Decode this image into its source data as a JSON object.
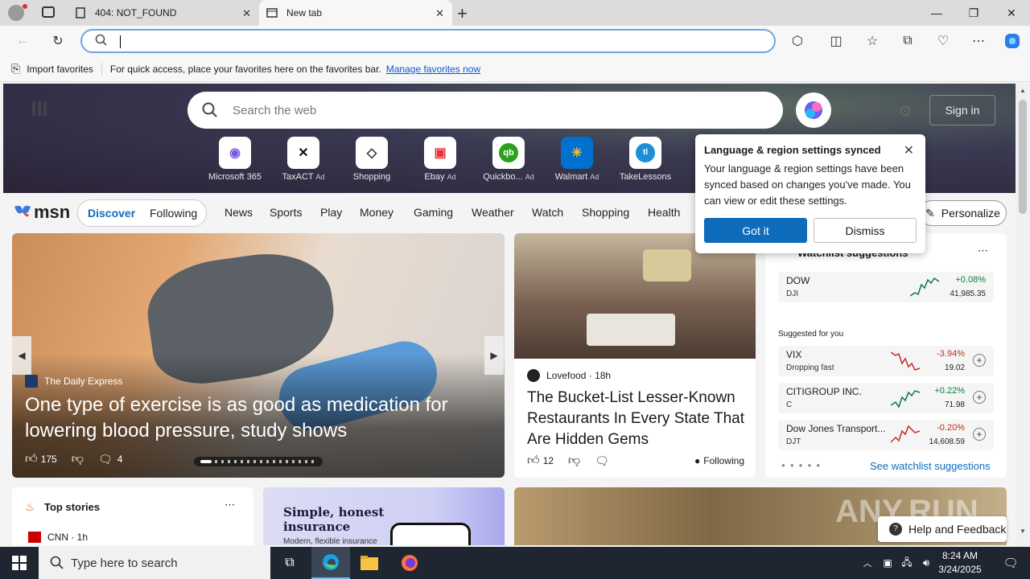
{
  "browser": {
    "tabs": [
      {
        "title": "404: NOT_FOUND"
      },
      {
        "title": "New tab"
      }
    ],
    "address_value": "",
    "favorites_bar": {
      "import_label": "Import favorites",
      "hint": "For quick access, place your favorites here on the favorites bar.",
      "manage_link": "Manage favorites now"
    }
  },
  "msn": {
    "search_placeholder": "Search the web",
    "sign_in": "Sign in",
    "quick_links": [
      {
        "label": "Microsoft 365",
        "ad": ""
      },
      {
        "label": "TaxACT",
        "ad": "Ad"
      },
      {
        "label": "Shopping",
        "ad": ""
      },
      {
        "label": "Ebay",
        "ad": "Ad"
      },
      {
        "label": "Quickbo...",
        "ad": "Ad"
      },
      {
        "label": "Walmart",
        "ad": "Ad"
      },
      {
        "label": "TakeLessons",
        "ad": ""
      }
    ],
    "logo": "msn",
    "discover": "Discover",
    "following": "Following",
    "nav": [
      "News",
      "Sports",
      "Play",
      "Money",
      "Gaming",
      "Weather",
      "Watch",
      "Shopping",
      "Health"
    ],
    "personalize": "Personalize"
  },
  "popup": {
    "title": "Language & region settings synced",
    "message": "Your language & region settings have been synced based on changes you've made. You can view or edit these settings.",
    "got_it": "Got it",
    "dismiss": "Dismiss"
  },
  "main_article": {
    "source": "The Daily Express",
    "headline": "One type of exercise is as good as medication for lowering blood pressure, study shows",
    "likes": "175",
    "comments": "4"
  },
  "second_article": {
    "source": "Lovefood",
    "age": "· 18h",
    "headline": "The Bucket-List Lesser-Known Restaurants In Every State That Are Hidden Gems",
    "likes": "12",
    "following": "Following"
  },
  "watchlist": {
    "title": "Watchlist suggestions",
    "suggested_label": "Suggested for you",
    "see_more": "See watchlist suggestions",
    "featured": {
      "name": "DOW",
      "symbol": "DJI",
      "change": "+0.08%",
      "price": "41,985.35"
    },
    "items": [
      {
        "name": "VIX",
        "symbol": "Dropping fast",
        "change": "-3.94%",
        "price": "19.02"
      },
      {
        "name": "CITIGROUP INC.",
        "symbol": "C",
        "change": "+0.22%",
        "price": "71.98"
      },
      {
        "name": "Dow Jones Transport...",
        "symbol": "DJT",
        "change": "-0.20%",
        "price": "14,608.59"
      }
    ]
  },
  "top_stories": {
    "title": "Top stories",
    "item_source": "CNN · 1h"
  },
  "ad_card": {
    "headline": "Simple, honest insurance",
    "sub": "Modern, flexible insurance"
  },
  "help": "Help and Feedback",
  "watermark": "ANY.RUN",
  "taskbar": {
    "search_placeholder": "Type here to search",
    "time": "8:24 AM",
    "date": "3/24/2025"
  }
}
